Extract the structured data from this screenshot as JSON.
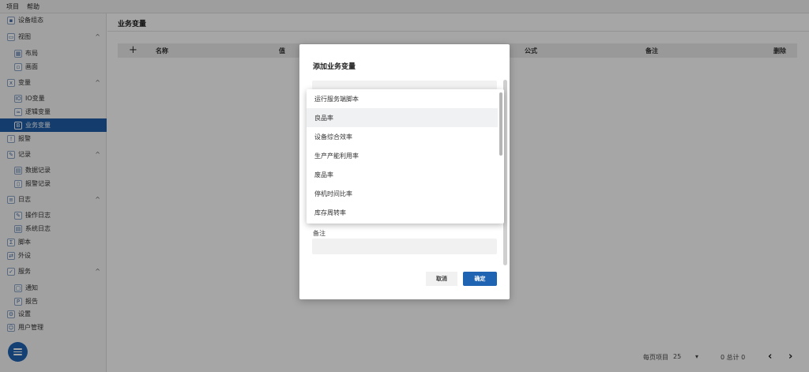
{
  "menubar": {
    "items": [
      "项目",
      "帮助"
    ]
  },
  "sidebar": {
    "items": [
      {
        "label": "设备组态",
        "icon": "device-config-icon",
        "level": "top",
        "chevron": "",
        "active": false
      },
      {
        "label": "视图",
        "icon": "view-icon",
        "level": "top",
        "chevron": "^",
        "active": false
      },
      {
        "label": "布局",
        "icon": "layout-icon",
        "level": "sub",
        "chevron": "",
        "active": false
      },
      {
        "label": "画面",
        "icon": "screen-icon",
        "level": "sub",
        "chevron": "",
        "active": false
      },
      {
        "label": "变量",
        "icon": "variable-icon",
        "level": "top",
        "chevron": "^",
        "active": false
      },
      {
        "label": "IO变量",
        "icon": "io-variable-icon",
        "level": "sub",
        "chevron": "",
        "active": false
      },
      {
        "label": "逻辑变量",
        "icon": "logic-variable-icon",
        "level": "sub",
        "chevron": "",
        "active": false
      },
      {
        "label": "业务变量",
        "icon": "business-variable-icon",
        "level": "sub",
        "chevron": "",
        "active": true
      },
      {
        "label": "报警",
        "icon": "alarm-icon",
        "level": "top",
        "chevron": "",
        "active": false
      },
      {
        "label": "记录",
        "icon": "record-icon",
        "level": "top",
        "chevron": "^",
        "active": false
      },
      {
        "label": "数据记录",
        "icon": "data-record-icon",
        "level": "sub",
        "chevron": "",
        "active": false
      },
      {
        "label": "报警记录",
        "icon": "alarm-record-icon",
        "level": "sub",
        "chevron": "",
        "active": false
      },
      {
        "label": "日志",
        "icon": "log-icon",
        "level": "top",
        "chevron": "^",
        "active": false
      },
      {
        "label": "操作日志",
        "icon": "operation-log-icon",
        "level": "sub",
        "chevron": "",
        "active": false
      },
      {
        "label": "系统日志",
        "icon": "system-log-icon",
        "level": "sub",
        "chevron": "",
        "active": false
      },
      {
        "label": "脚本",
        "icon": "script-icon",
        "level": "top",
        "chevron": "",
        "active": false
      },
      {
        "label": "外设",
        "icon": "peripheral-icon",
        "level": "top",
        "chevron": "",
        "active": false
      },
      {
        "label": "服务",
        "icon": "service-icon",
        "level": "top",
        "chevron": "^",
        "active": false
      },
      {
        "label": "通知",
        "icon": "notification-icon",
        "level": "sub",
        "chevron": "",
        "active": false
      },
      {
        "label": "报告",
        "icon": "report-icon",
        "level": "sub",
        "chevron": "",
        "active": false
      },
      {
        "label": "设置",
        "icon": "gear-icon",
        "level": "top",
        "chevron": "",
        "active": false
      },
      {
        "label": "用户管理",
        "icon": "user-management-icon",
        "level": "top",
        "chevron": "",
        "active": false
      }
    ]
  },
  "main": {
    "title": "业务变量",
    "table": {
      "add_symbol": "+",
      "columns": [
        "名称",
        "值",
        "公式",
        "备注",
        "删除"
      ]
    },
    "pager": {
      "items_per_page_label": "每页项目",
      "items_per_page_value": "25",
      "dropdown_glyph": "▾",
      "range_text": "0 总计 0",
      "prev_glyph": "‹",
      "next_glyph": "›"
    }
  },
  "modal": {
    "title": "添加业务变量",
    "remark_label": "备注",
    "cancel_label": "取消",
    "ok_label": "确定"
  },
  "dropdown": {
    "options": [
      "运行服务端脚本",
      "良品率",
      "设备综合效率",
      "生产产能利用率",
      "废品率",
      "停机时间比率",
      "库存周转率"
    ],
    "highlighted_index": 1
  },
  "colors": {
    "accent": "#1f63b3",
    "active_nav": "#1f5ea8",
    "overlay": "rgba(0,0,0,0.35)"
  }
}
